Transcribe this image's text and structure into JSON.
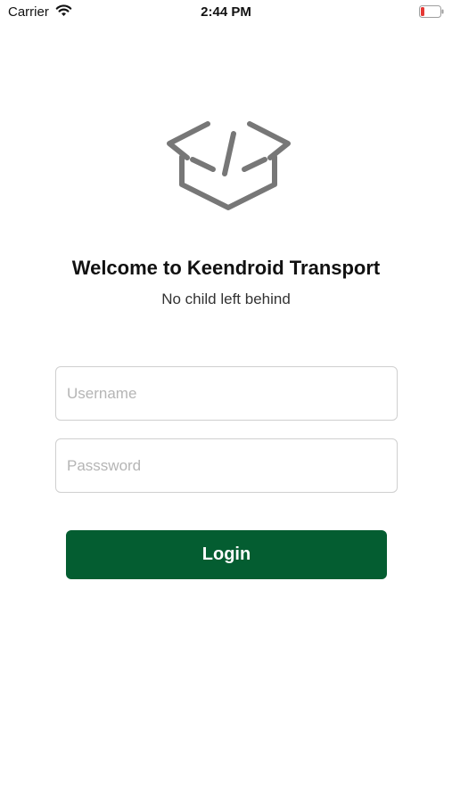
{
  "status_bar": {
    "carrier": "Carrier",
    "time": "2:44 PM",
    "battery_color": "#e53935"
  },
  "logo": {
    "icon": "code-box-icon",
    "color": "#777777"
  },
  "header": {
    "title": "Welcome to Keendroid Transport",
    "subtitle": "No child left behind"
  },
  "form": {
    "username_placeholder": "Username",
    "username_value": "",
    "password_placeholder": "Passsword",
    "password_value": "",
    "login_label": "Login",
    "login_color": "#045d31"
  }
}
